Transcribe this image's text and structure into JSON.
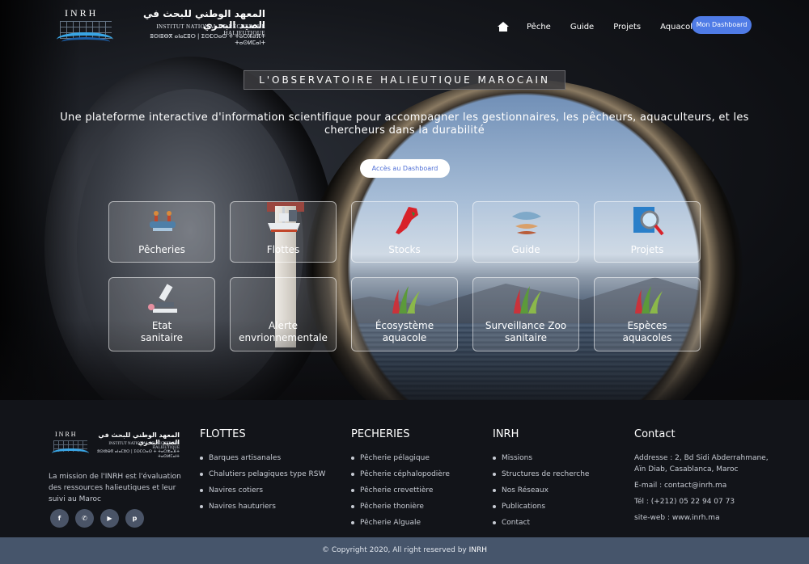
{
  "header": {
    "logo_mark": "INRH",
    "logo_arabic": "المعهد الوطني للبحث في الصيد البحري",
    "logo_french": "INSTITUT NATIONAL DE RECHERCHE HALIEUTIQUE",
    "logo_tifinagh": "ⵓⵙⵏⵓⴱⴳ ⴰⵏⴰⵎⵓⵔ | ⵉⵙⵎⵔⴰⵙ ⵜ ⵜⴰⵔⵣⴰⴼⵜ ⵜⴰⵙⵍⵎⴰⵏⵜ",
    "nav": {
      "home_icon": "home-icon",
      "items": [
        "Pêche",
        "Guide",
        "Projets",
        "Aquacole"
      ],
      "dashboard_button": "Mon Dashboard",
      "accent": "#4f7be6"
    }
  },
  "hero": {
    "title": "L'OBSERVATOIRE HALIEUTIQUE MAROCAIN",
    "tagline": "Une plateforme interactive d'information scientifique pour accompagner les gestionnaires, les pêcheurs, aquaculteurs, et les chercheurs dans la durabilité",
    "cta": "Accès au Dashboard"
  },
  "tiles": [
    {
      "label": "Pêcheries",
      "icon": "fishing-boat-icon"
    },
    {
      "label": "Flottes",
      "icon": "trawler-icon"
    },
    {
      "label": "Stocks",
      "icon": "morocco-map-icon"
    },
    {
      "label": "Guide",
      "icon": "fish-species-icon"
    },
    {
      "label": "Projets",
      "icon": "magnifier-icon"
    },
    {
      "label": "Etat",
      "label2": "sanitaire",
      "icon": "microscope-icon"
    },
    {
      "label": "Alerte",
      "label2": "envrionnementale",
      "icon": "lighthouse-icon"
    },
    {
      "label": "Écosystème",
      "label2": "aquacole",
      "icon": "algae-icon"
    },
    {
      "label": "Surveillance Zoo",
      "label2": "sanitaire",
      "icon": "algae-icon"
    },
    {
      "label": "Espèces",
      "label2": "aquacoles",
      "icon": "algae-icon"
    }
  ],
  "footer": {
    "mission": "La mission de l'INRH est l'évaluation des ressources halieutiques et leur suivi au Maroc",
    "socials": [
      "facebook-icon",
      "whatsapp-icon",
      "youtube-icon",
      "pinterest-icon"
    ],
    "social_glyphs": [
      "f",
      "✆",
      "▶",
      "p"
    ],
    "flottes": {
      "title": "FLOTTES",
      "items": [
        "Barques artisanales",
        "Chalutiers pelagiques type RSW",
        "Navires cotiers",
        "Navires hauturiers"
      ]
    },
    "pecheries": {
      "title": "PECHERIES",
      "items": [
        "Pêcherie pélagique",
        "Pêcherie céphalopodière",
        "Pêcherie crevettière",
        "Pêcherie thonière",
        "Pêcherie Alguale"
      ]
    },
    "inrh": {
      "title": "INRH",
      "items": [
        "Missions",
        "Structures de recherche",
        "Nos Réseaux",
        "Publications",
        "Contact"
      ]
    },
    "contact": {
      "title": "Contact",
      "address": "Addresse : 2, Bd Sidi Abderrahmane, Aïn Diab, Casablanca, Maroc",
      "email": "E-mail : contact@inrh.ma",
      "tel": "Tél : (+212) 05 22 94 07 73",
      "site": "site-web : www.inrh.ma"
    }
  },
  "copyright": {
    "text": "© Copyright 2020, All right reserved by ",
    "brand": "INRH"
  }
}
